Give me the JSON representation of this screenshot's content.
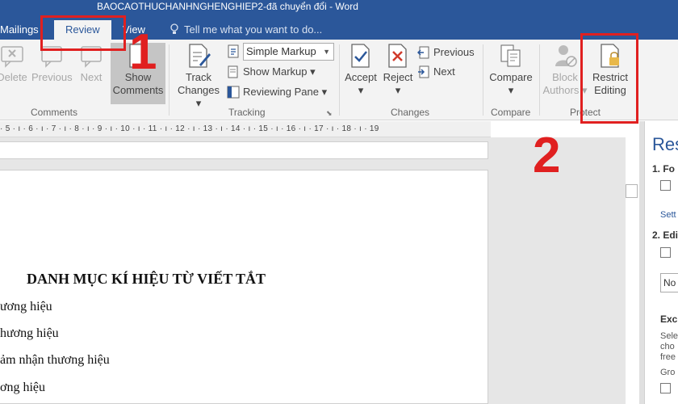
{
  "window": {
    "title": "BAOCAOTHUCHANHNGHENGHIEP2-đã chuyển đổi - Word"
  },
  "tabs": [
    {
      "label": "Mailings",
      "active": false
    },
    {
      "label": "Review",
      "active": true
    },
    {
      "label": "View",
      "active": false
    }
  ],
  "tell_me": {
    "placeholder": "Tell me what you want to do..."
  },
  "ribbon": {
    "comments": {
      "group_label": "Comments",
      "delete_label": "Delete",
      "previous_label": "Previous",
      "next_label": "Next",
      "show_comments_label_1": "Show",
      "show_comments_label_2": "Comments"
    },
    "tracking": {
      "group_label": "Tracking",
      "track_changes_label_1": "Track",
      "track_changes_label_2": "Changes",
      "markup_select_value": "Simple Markup",
      "show_markup_label": "Show Markup",
      "reviewing_pane_label": "Reviewing Pane"
    },
    "changes": {
      "group_label": "Changes",
      "accept_label": "Accept",
      "reject_label": "Reject",
      "previous_label": "Previous",
      "next_label": "Next"
    },
    "compare": {
      "group_label": "Compare",
      "compare_label": "Compare"
    },
    "protect": {
      "group_label": "Protect",
      "block_authors_label_1": "Block",
      "block_authors_label_2": "Authors",
      "restrict_editing_label_1": "Restrict",
      "restrict_editing_label_2": "Editing"
    }
  },
  "ruler": {
    "ticks": "· 5 · ı · 6 · ı · 7 · ı · 8 · ı · 9 · ı · 10 · ı · 11 · ı · 12 · ı · 13 · ı · 14 · ı · 15 · ı · 16 · ı · 17 · ı · 18 · ı · 19"
  },
  "document": {
    "heading": "DANH MỤC KÍ HIỆU TỪ VIẾT TẮT",
    "lines": [
      "ương hiệu",
      "hương hiệu",
      "ảm nhận thương hiệu",
      "ơng hiệu"
    ]
  },
  "side_pane": {
    "title": "Res",
    "section_1": "1. Fo",
    "link_1": "Sett",
    "section_2": "2. Edi",
    "dropdown_value": "No",
    "exceptions_heading": "Exc",
    "exceptions_text": [
      "Sele",
      "cho",
      "free"
    ],
    "groups_label": "Gro"
  },
  "annotations": {
    "step_1": "1",
    "step_2": "2",
    "color": "#e02020"
  },
  "colors": {
    "accent": "#2b579a",
    "ribbon_bg": "#f3f3f3"
  }
}
